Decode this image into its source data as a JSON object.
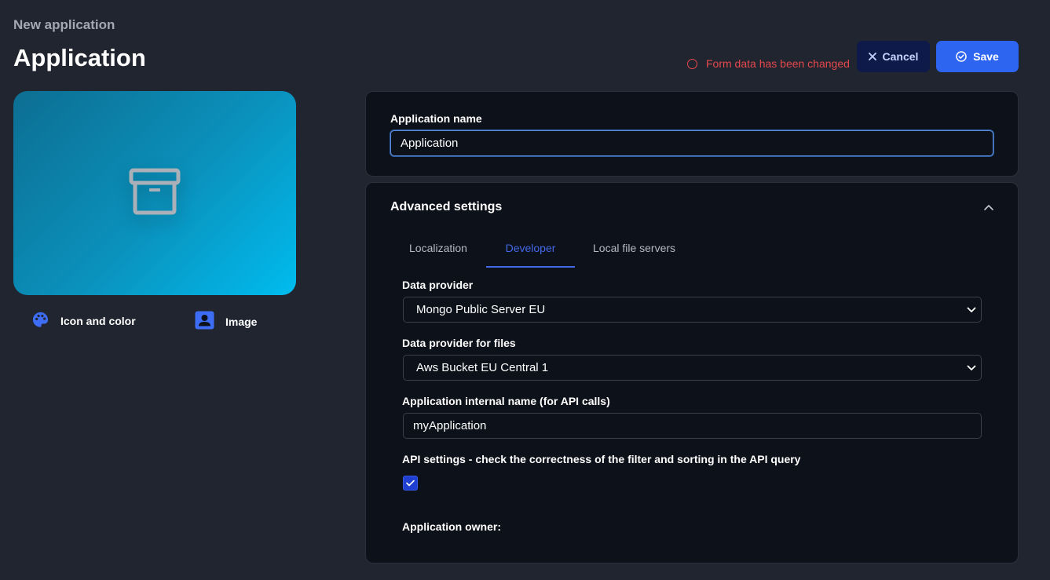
{
  "header": {
    "breadcrumb": "New application",
    "title": "Application",
    "changed_notice": "Form data has been changed",
    "cancel_label": "Cancel",
    "save_label": "Save"
  },
  "preview": {
    "icon": "archive-icon",
    "gradient": [
      "#0d6e92",
      "#00bcef"
    ]
  },
  "media_options": {
    "icon_color_label": "Icon and color",
    "image_label": "Image"
  },
  "name_panel": {
    "label": "Application name",
    "value": "Application"
  },
  "advanced": {
    "title": "Advanced settings",
    "tabs": [
      {
        "label": "Localization",
        "active": false
      },
      {
        "label": "Developer",
        "active": true
      },
      {
        "label": "Local file servers",
        "active": false
      }
    ],
    "data_provider_label": "Data provider",
    "data_provider_value": "Mongo Public Server EU",
    "files_provider_label": "Data provider for files",
    "files_provider_value": "Aws Bucket EU Central 1",
    "internal_name_label": "Application internal name (for API calls)",
    "internal_name_value": "myApplication",
    "api_settings_label": "API settings - check the correctness of the filter and sorting in the API query",
    "api_settings_checked": true,
    "owner_label": "Application owner:"
  },
  "colors": {
    "accent": "#2d64f0",
    "warning": "#e5484d",
    "active_tab": "#4468e8"
  }
}
